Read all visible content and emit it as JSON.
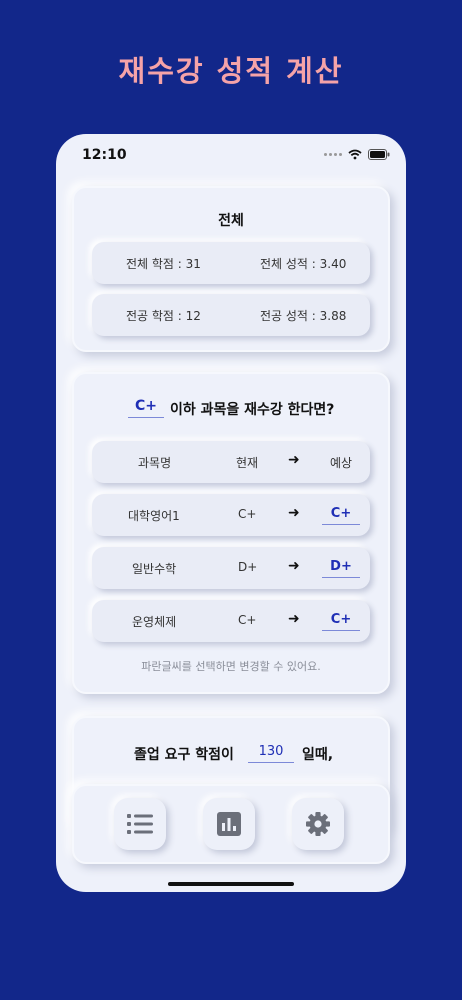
{
  "promo_title": "재수강 성적 계산",
  "status": {
    "time": "12:10"
  },
  "summary": {
    "title": "전체",
    "rows": [
      {
        "left": "전체 학점 : 31",
        "right": "전체 성적 : 3.40"
      },
      {
        "left": "전공 학점 : 12",
        "right": "전공 성적 : 3.88"
      }
    ]
  },
  "retake": {
    "threshold_grade": "C+",
    "question": "이하 과목을 재수강 한다면?",
    "header": {
      "course": "과목명",
      "current": "현재",
      "arrow": "➜",
      "expected": "예상"
    },
    "rows": [
      {
        "course": "대학영어1",
        "current": "C+",
        "arrow": "➜",
        "expected": "C+"
      },
      {
        "course": "일반수학",
        "current": "D+",
        "arrow": "➜",
        "expected": "D+"
      },
      {
        "course": "운영체제",
        "current": "C+",
        "arrow": "➜",
        "expected": "C+"
      }
    ],
    "hint": "파란글씨를 선택하면 변경할 수 있어요."
  },
  "graduation": {
    "prefix": "졸업 요구 학점이",
    "credits": "130",
    "suffix": "일때,"
  },
  "tabbar": {
    "tabs": [
      "list-icon",
      "chart-icon",
      "gear-icon"
    ],
    "icon_color": "#6b6f7a"
  },
  "colors": {
    "background": "#12278a",
    "promo": "#f5a3a8",
    "accent": "#1f2fb5"
  }
}
